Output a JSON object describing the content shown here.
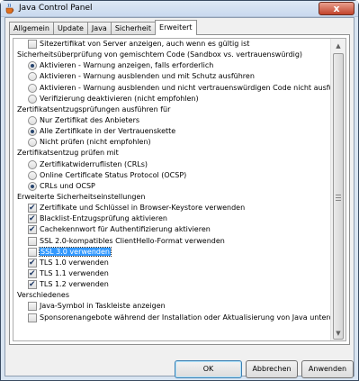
{
  "window": {
    "title": "Java Control Panel",
    "close_symbol": "x"
  },
  "tabs": [
    {
      "label": "Allgemein",
      "active": false
    },
    {
      "label": "Update",
      "active": false
    },
    {
      "label": "Java",
      "active": false
    },
    {
      "label": "Sicherheit",
      "active": false
    },
    {
      "label": "Erweitert",
      "active": true
    }
  ],
  "settings": [
    {
      "type": "checkbox",
      "label": "Sitezertifikat von Server anzeigen, auch wenn es gültig ist",
      "checked": false
    },
    {
      "type": "header",
      "label": "Sicherheitsüberprüfung von gemischtem Code (Sandbox vs. vertrauenswürdig)"
    },
    {
      "type": "radio",
      "label": "Aktivieren - Warnung anzeigen, falls erforderlich",
      "checked": true
    },
    {
      "type": "radio",
      "label": "Aktivieren - Warnung ausblenden und mit Schutz ausführen",
      "checked": false
    },
    {
      "type": "radio",
      "label": "Aktivieren - Warnung ausblenden und nicht vertrauenswürdigen Code nicht ausführen",
      "checked": false
    },
    {
      "type": "radio",
      "label": "Verifizierung deaktivieren (nicht empfohlen)",
      "checked": false
    },
    {
      "type": "header",
      "label": "Zertifikatsentzugsprüfungen ausführen für"
    },
    {
      "type": "radio",
      "label": "Nur Zertifikat des Anbieters",
      "checked": false
    },
    {
      "type": "radio",
      "label": "Alle Zertifikate in der Vertrauenskette",
      "checked": true
    },
    {
      "type": "radio",
      "label": "Nicht prüfen (nicht empfohlen)",
      "checked": false
    },
    {
      "type": "header",
      "label": "Zertifikatsentzug prüfen mit"
    },
    {
      "type": "radio",
      "label": "Zertifikatwiderruflisten (CRLs)",
      "checked": false
    },
    {
      "type": "radio",
      "label": "Online Certificate Status Protocol (OCSP)",
      "checked": false
    },
    {
      "type": "radio",
      "label": "CRLs und OCSP",
      "checked": true
    },
    {
      "type": "header",
      "label": "Erweiterte Sicherheitseinstellungen"
    },
    {
      "type": "checkbox",
      "label": "Zertifikate und Schlüssel in Browser-Keystore verwenden",
      "checked": true
    },
    {
      "type": "checkbox",
      "label": "Blacklist-Entzugsprüfung aktivieren",
      "checked": true
    },
    {
      "type": "checkbox",
      "label": "Cachekennwort für Authentifizierung aktivieren",
      "checked": true
    },
    {
      "type": "checkbox",
      "label": "SSL 2.0-kompatibles ClientHello-Format verwenden",
      "checked": false
    },
    {
      "type": "checkbox",
      "label": "SSL 3.0 verwenden",
      "checked": false,
      "selected": true
    },
    {
      "type": "checkbox",
      "label": "TLS 1.0 verwenden",
      "checked": true
    },
    {
      "type": "checkbox",
      "label": "TLS 1.1 verwenden",
      "checked": true
    },
    {
      "type": "checkbox",
      "label": "TLS 1.2 verwenden",
      "checked": true
    },
    {
      "type": "header",
      "label": "Verschiedenes"
    },
    {
      "type": "checkbox",
      "label": "Java-Symbol in Taskleiste anzeigen",
      "checked": false
    },
    {
      "type": "checkbox",
      "label": "Sponsorenangebote während der Installation oder Aktualisierung von Java unterdrücken",
      "checked": false
    }
  ],
  "scrollbar": {
    "up_symbol": "▲",
    "down_symbol": "▼"
  },
  "buttons": {
    "ok": "OK",
    "cancel": "Abbrechen",
    "apply": "Anwenden"
  }
}
